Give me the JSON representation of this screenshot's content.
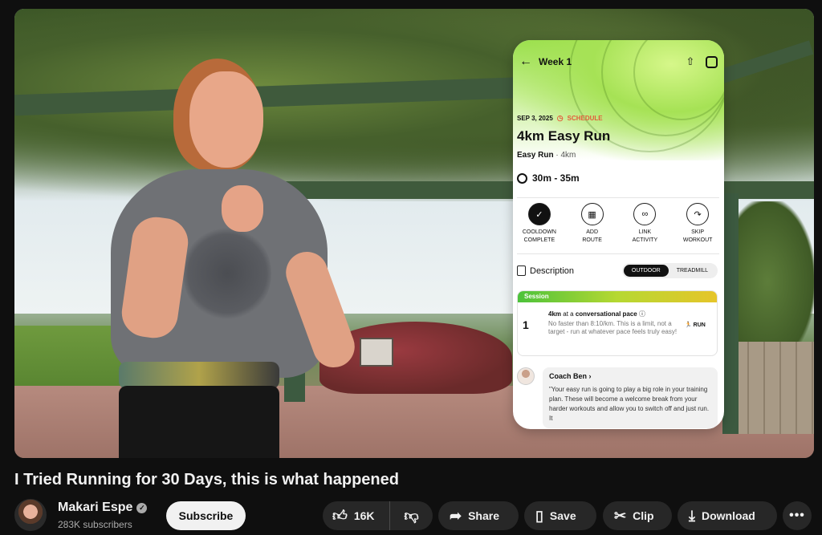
{
  "video": {
    "title": "I Tried Running for 30 Days, this is what happened"
  },
  "channel": {
    "name": "Makari Espe",
    "subscribers": "283K subscribers",
    "subscribe_label": "Subscribe",
    "verified_icon": "✓"
  },
  "actions": {
    "like_count": "16K",
    "share_label": "Share",
    "save_label": "Save",
    "clip_label": "Clip",
    "download_label": "Download",
    "more_label": "•••"
  },
  "overlay_card": {
    "week": "Week 1",
    "date": "SEP 3, 2025",
    "schedule_label": "SCHEDULE",
    "workout_title": "4km Easy Run",
    "workout_type": "Easy Run",
    "workout_distance": "4km",
    "duration": "30m - 35m",
    "actions": [
      {
        "label_line1": "COOLDOWN",
        "label_line2": "COMPLETE",
        "icon": "check-icon"
      },
      {
        "label_line1": "ADD",
        "label_line2": "ROUTE",
        "icon": "map-icon"
      },
      {
        "label_line1": "LINK",
        "label_line2": "ACTIVITY",
        "icon": "link-icon"
      },
      {
        "label_line1": "SKIP",
        "label_line2": "WORKOUT",
        "icon": "skip-icon"
      }
    ],
    "description_label": "Description",
    "tabs": [
      "OUTDOOR",
      "TREADMILL"
    ],
    "session_label": "Session",
    "session_number": "1",
    "session_line1_a": "4km",
    "session_line1_b": "at a",
    "session_line1_c": "conversational pace",
    "session_line2": "No faster than 8:10/km. This is a limit, not a target - run at whatever pace feels truly easy!",
    "session_tag": "RUN",
    "coach_name": "Coach Ben",
    "coach_message": "\"Your easy run is going to play a big role in your training plan. These will become a welcome break from your harder workouts and allow you to switch off and just run. It"
  },
  "colors": {
    "background": "#0f0f0f",
    "pill": "#272727",
    "accent_green": "#9adf4c",
    "schedule_red": "#e25c3a"
  }
}
